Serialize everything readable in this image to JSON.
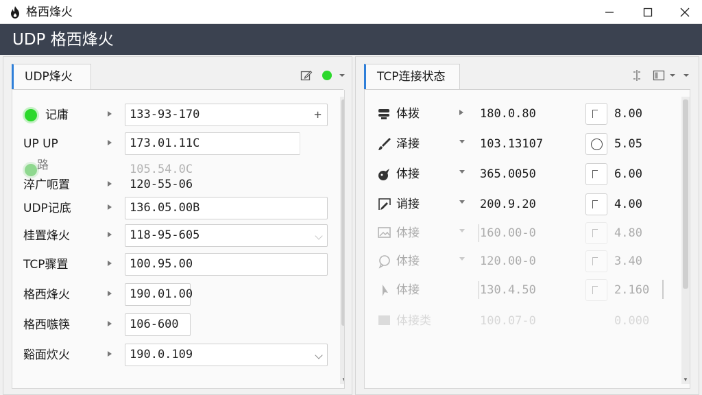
{
  "window": {
    "title": "格西烽火"
  },
  "header": {
    "title": "UDP 格西烽火"
  },
  "left_panel": {
    "tab_label": "UDP烽火",
    "status_color": "#2bd82b",
    "rows": [
      {
        "label": "记庸",
        "value": "133-93-170",
        "suffix": "+"
      },
      {
        "label": "UP  UP",
        "value": "173.01.11C"
      },
      {
        "label": "路",
        "value": "105.54.0C"
      },
      {
        "label": "淬广呃置",
        "value": "120-55-06"
      },
      {
        "label": "UDP记底",
        "value": "136.05.00B"
      },
      {
        "label": "桂置烽火",
        "value": "118-95-605"
      },
      {
        "label": "TCP骤置",
        "value": "100.95.00"
      },
      {
        "label": "格西烽火",
        "value": "190.01.00"
      },
      {
        "label": "格西嗾筷",
        "value": "106-600"
      },
      {
        "label": "谿面炊火",
        "value": "190.0.109"
      }
    ]
  },
  "right_panel": {
    "tab_label": "TCP连接状态",
    "rows": [
      {
        "icon": "database-icon",
        "label": "体拨",
        "value": "180.0.80",
        "number": "8.00"
      },
      {
        "icon": "brush-icon",
        "label": "泽接",
        "value": "103.13107",
        "number": "5.05"
      },
      {
        "icon": "bird-icon",
        "label": "体接",
        "value": "365.0050",
        "number": "6.00"
      },
      {
        "icon": "edit-frame-icon",
        "label": "诮接",
        "value": "200.9.20",
        "number": "4.00"
      },
      {
        "icon": "image-icon",
        "label": "体接",
        "value": "160.00-0",
        "number": "4.80"
      },
      {
        "icon": "chat-icon",
        "label": "体接",
        "value": "120.00-0",
        "number": "3.40"
      },
      {
        "icon": "pointer-icon",
        "label": "体接",
        "value": "130.4.50",
        "number": "2.160"
      },
      {
        "icon": "image-icon",
        "label": "体接类",
        "value": "100.07-0",
        "number": "0.000"
      }
    ]
  }
}
